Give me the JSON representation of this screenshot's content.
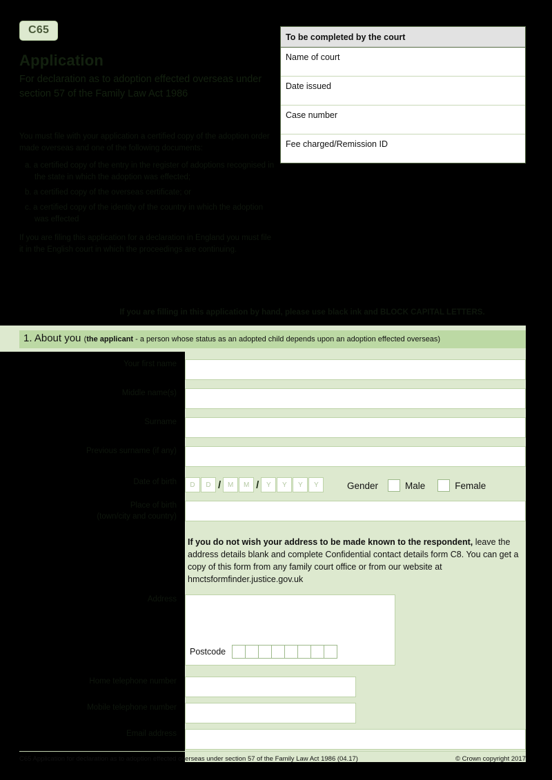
{
  "form": {
    "code": "C65",
    "title": "Application",
    "subtitle": "For declaration as to adoption effected overseas under section 57 of the Family Law Act 1986",
    "intro": "You must file with your application a certified copy of the adoption order made overseas and one of the following documents:",
    "documents": [
      "a. a certified copy of the entry in the register of adoptions recognised in the state in which the adoption was effected;",
      "b. a certified copy of the overseas certificate; or",
      "c. a certified copy of the identity of the country in which the adoption was effected",
      "If you are filing this application for a declaration in England you must file it in the English court in which the proceedings are continuing."
    ],
    "handwriting_note_bold": "If you are filling in this application by hand, please use black ink and BLOCK CAPITAL LETTERS.",
    "footer_left": "C65 Application for declaration as to adoption effected overseas under section 57 of the Family Law Act 1986 (04.17)",
    "footer_right": "© Crown copyright 2017"
  },
  "court_table": {
    "heading": "To be completed by the court",
    "rows": [
      {
        "label": "Name of court"
      },
      {
        "label": "Date issued"
      },
      {
        "label": "Case number"
      },
      {
        "label": "Fee charged/Remission ID"
      }
    ]
  },
  "section1": {
    "number": "1. About you ",
    "paren_open": "(",
    "strong": "the applicant",
    "paren_rest": " - a person whose status as an adopted child depends upon an adoption effected overseas)"
  },
  "fields": {
    "first_name": {
      "label": "Your first name",
      "value": ""
    },
    "middle_name": {
      "label": "Middle name(s)",
      "value": ""
    },
    "surname": {
      "label": "Surname",
      "value": ""
    },
    "previous_surname": {
      "label": "Previous surname (if any)",
      "value": ""
    },
    "date_of_birth": {
      "label": "Date of birth",
      "boxes": [
        "D",
        "D",
        "M",
        "M",
        "Y",
        "Y",
        "Y",
        "Y"
      ],
      "separator": "/"
    },
    "place_of_birth": {
      "label": "Place of birth\n(town/city and country)",
      "label_line1": "Place of birth",
      "label_line2": "(town/city and country)",
      "value": ""
    },
    "address": {
      "label": "Address",
      "value": ""
    },
    "postcode": {
      "label": "Postcode",
      "box_count": 8
    },
    "home_phone": {
      "label": "Home telephone number",
      "value": ""
    },
    "mobile_phone": {
      "label": "Mobile telephone number",
      "value": ""
    },
    "email": {
      "label": "Email address",
      "value": ""
    }
  },
  "gender": {
    "label": "Gender",
    "options": [
      {
        "label": "Male",
        "checked": false
      },
      {
        "label": "Female",
        "checked": false
      }
    ]
  },
  "confidential_notice": {
    "bold": "If you do not wish your address to be made known to the respondent,",
    "rest": " leave the address details blank and complete Confidential contact details form C8. You can get a copy of this form from any family court office or from our website at hmctsformfinder.justice.gov.uk"
  },
  "colors": {
    "page_green": "#dde9cf",
    "section_bar": "#bcd9a4",
    "field_border": "#bdd3a8",
    "table_head": "#e2e2e2",
    "overlay": "#000000"
  }
}
